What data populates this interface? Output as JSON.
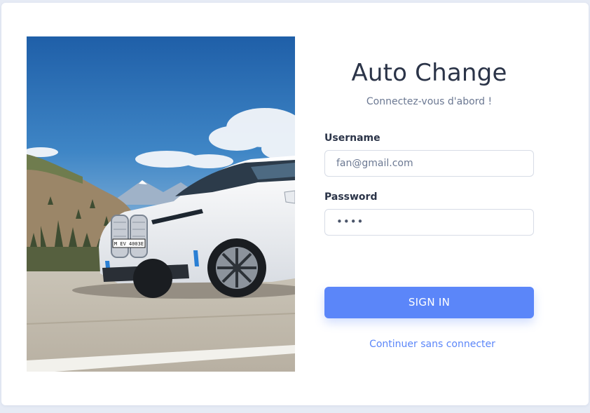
{
  "login": {
    "title": "Auto Change",
    "subtitle": "Connectez-vous d'abord !",
    "username_label": "Username",
    "username_value": "fan@gmail.com",
    "password_label": "Password",
    "password_value": "••••",
    "submit_label": "SIGN IN",
    "guest_link": "Continuer sans connecter"
  },
  "hero": {
    "image": "white electric SUV parked in mountain landscape",
    "plate_text": "M EV 4003E"
  },
  "colors": {
    "accent": "#5b86f9",
    "heading": "#2b3448",
    "muted": "#6b7892",
    "background": "#e6ebf5"
  }
}
